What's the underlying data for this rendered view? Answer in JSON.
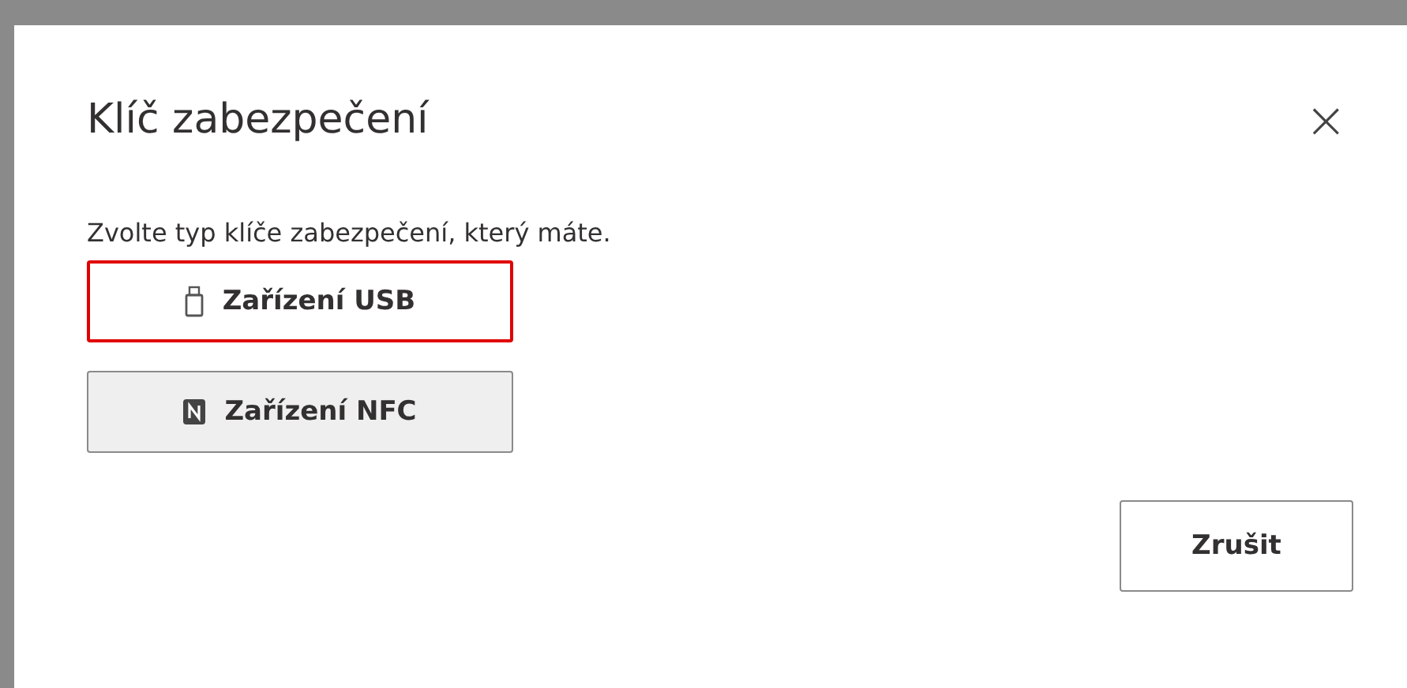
{
  "dialog": {
    "title": "Klíč zabezpečení",
    "close": "×",
    "prompt": "Zvolte typ klíče zabezpečení, který máte.",
    "options": [
      {
        "kind": "usb",
        "label": "Zařízení USB",
        "highlighted": true
      },
      {
        "kind": "nfc",
        "label": "Zařízení NFC",
        "highlighted": false
      }
    ],
    "buttons": [
      "Zrušit"
    ]
  }
}
